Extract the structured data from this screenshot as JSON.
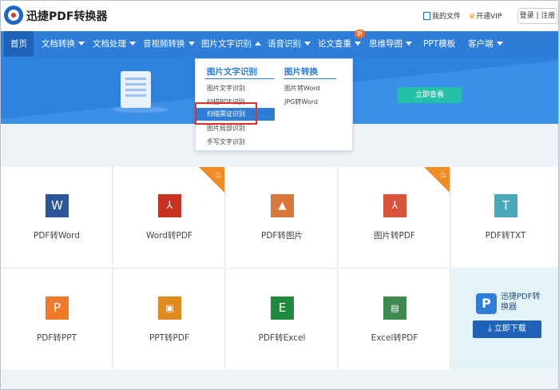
{
  "header": {
    "brand": "迅捷PDF转换器",
    "my_files": "我的文件",
    "vip": "开通VIP",
    "login": "登录",
    "separator": "|",
    "register": "注册"
  },
  "nav": {
    "items": [
      {
        "label": "首页"
      },
      {
        "label": "文档转换"
      },
      {
        "label": "文档处理"
      },
      {
        "label": "音视频转换"
      },
      {
        "label": "图片文字识别"
      },
      {
        "label": "语音识别"
      },
      {
        "label": "论文查重"
      },
      {
        "label": "思维导图"
      },
      {
        "label": "PPT模板"
      },
      {
        "label": "客户端"
      }
    ],
    "new_badge": "新"
  },
  "banner": {
    "button": "立即查看"
  },
  "dropdown": {
    "col1_title": "图片文字识别",
    "col1_items": [
      "图片文字识别",
      "扫描PDF识别",
      "扫描票证识别",
      "图片局部识别",
      "手写文字识别"
    ],
    "col2_title": "图片转换",
    "col2_items": [
      "图片转Word",
      "JPG转Word"
    ]
  },
  "tools": [
    {
      "label": "PDF转Word",
      "icon": "W",
      "color": "#2b579a",
      "hot": false
    },
    {
      "label": "Word转PDF",
      "icon": "pdf",
      "color": "#c8311f",
      "hot": false
    },
    {
      "label": "PDF转图片",
      "icon": "img",
      "color": "#d9773a",
      "hot": true
    },
    {
      "label": "图片转PDF",
      "icon": "pdf",
      "color": "#d9533a",
      "hot": false
    },
    {
      "label": "PDF转TXT",
      "icon": "T",
      "color": "#4aa9b8",
      "hot": true
    },
    {
      "label": "PDF转PPT",
      "icon": "P",
      "color": "#f07a2a",
      "hot": false
    },
    {
      "label": "PPT转PDF",
      "icon": "ppt",
      "color": "#e08a1e",
      "hot": false
    },
    {
      "label": "PDF转Excel",
      "icon": "E",
      "color": "#1e8a3e",
      "hot": false
    },
    {
      "label": "Excel转PDF",
      "icon": "pdf",
      "color": "#3e8a4e",
      "hot": false
    }
  ],
  "promo": {
    "name": "迅捷PDF转换器",
    "button": "立即下载"
  }
}
